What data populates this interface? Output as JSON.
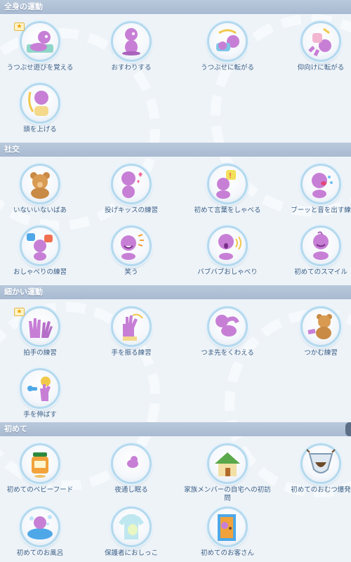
{
  "sections": [
    {
      "title": "全身の運動",
      "items": [
        {
          "label": "うつぶせ遊びを覚える",
          "icon": "baby-on-mat-icon",
          "starred": true
        },
        {
          "label": "おすわりする",
          "icon": "baby-sitting-icon"
        },
        {
          "label": "うつぶせに転がる",
          "icon": "baby-rolling-prone-icon"
        },
        {
          "label": "仰向けに転がる",
          "icon": "baby-rolling-back-icon"
        },
        {
          "label": "頭を上げる",
          "icon": "baby-lifting-head-icon"
        }
      ]
    },
    {
      "title": "社交",
      "items": [
        {
          "label": "いないいないばあ",
          "icon": "teddy-peekaboo-icon"
        },
        {
          "label": "投げキッスの練習",
          "icon": "blow-kiss-icon"
        },
        {
          "label": "初めて言葉をしゃべる",
          "icon": "first-words-icon"
        },
        {
          "label": "ブーッと音を出す練",
          "icon": "raspberry-icon"
        },
        {
          "label": "おしゃべりの練習",
          "icon": "chatter-icon"
        },
        {
          "label": "笑う",
          "icon": "laugh-icon"
        },
        {
          "label": "バブバブおしゃべり",
          "icon": "babble-icon"
        },
        {
          "label": "初めてのスマイル",
          "icon": "first-smile-icon"
        }
      ]
    },
    {
      "title": "細かい運動",
      "items": [
        {
          "label": "拍手の練習",
          "icon": "clapping-hands-icon",
          "starred": true
        },
        {
          "label": "手を振る練習",
          "icon": "waving-hand-icon"
        },
        {
          "label": "つま先をくわえる",
          "icon": "toe-suck-icon"
        },
        {
          "label": "つかむ練習",
          "icon": "grab-teddy-icon"
        },
        {
          "label": "手を伸ばす",
          "icon": "reach-rattle-icon"
        }
      ]
    },
    {
      "title": "初めて",
      "items": [
        {
          "label": "初めてのベビーフード",
          "icon": "baby-food-jar-icon"
        },
        {
          "label": "夜通し眠る",
          "icon": "sleep-moon-icon"
        },
        {
          "label": "家族メンバーの自宅への初訪問",
          "icon": "house-visit-icon"
        },
        {
          "label": "初めてのおむつ爆発",
          "icon": "diaper-blowout-icon"
        },
        {
          "label": "初めてのお風呂",
          "icon": "first-bath-icon"
        },
        {
          "label": "保護者におしっこ",
          "icon": "pee-shirt-icon"
        },
        {
          "label": "初めてのお客さん",
          "icon": "door-guest-icon"
        }
      ]
    }
  ],
  "star_glyph": "★",
  "colors": {
    "header": "#a8bad1",
    "label": "#3b5f86",
    "ring": "#b4d9ee",
    "baby": "#c77fd6"
  }
}
